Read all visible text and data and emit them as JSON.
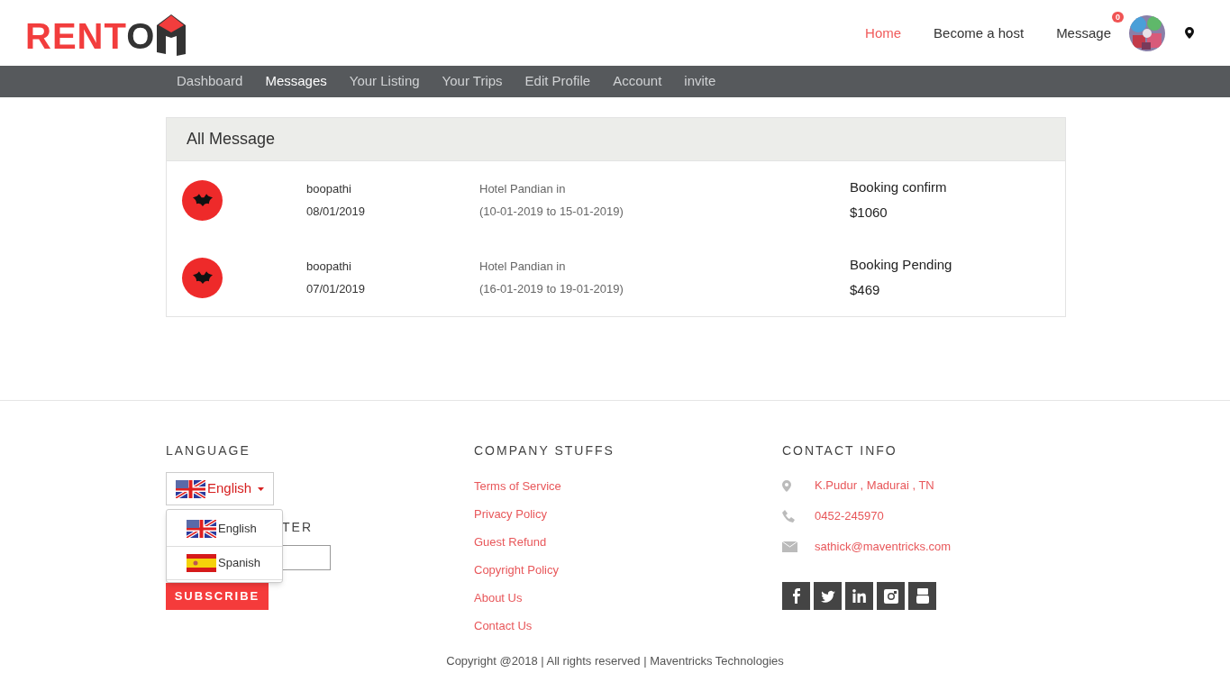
{
  "logo": {
    "text_main": "RENT",
    "text_accent": "O"
  },
  "top_nav": [
    {
      "label": "Home",
      "selected": true
    },
    {
      "label": "Become a host",
      "selected": false
    },
    {
      "label": "Message",
      "selected": false,
      "badge": "0"
    }
  ],
  "sub_nav": [
    {
      "label": "Dashboard",
      "selected": false
    },
    {
      "label": "Messages",
      "selected": true
    },
    {
      "label": "Your Listing",
      "selected": false
    },
    {
      "label": "Your Trips",
      "selected": false
    },
    {
      "label": "Edit Profile",
      "selected": false
    },
    {
      "label": "Account",
      "selected": false
    },
    {
      "label": "invite",
      "selected": false
    }
  ],
  "messages": {
    "title": "All Message",
    "rows": [
      {
        "name": "boopathi",
        "date": "08/01/2019",
        "listing": "Hotel Pandian in",
        "dates": "(10-01-2019 to 15-01-2019)",
        "status": "Booking confirm",
        "amount": "$1060"
      },
      {
        "name": "boopathi",
        "date": "07/01/2019",
        "listing": "Hotel Pandian in",
        "dates": "(16-01-2019 to 19-01-2019)",
        "status": "Booking Pending",
        "amount": "$469"
      }
    ]
  },
  "footer": {
    "language": {
      "heading": "LANGUAGE",
      "current": "English",
      "expanded": true,
      "options": [
        {
          "label": "English",
          "kind": "uk"
        },
        {
          "label": "Spanish",
          "kind": "es"
        }
      ]
    },
    "newsletter": {
      "heading": "TER",
      "button": "SUBSCRIBE"
    },
    "company": {
      "heading": "COMPANY STUFFS",
      "links": [
        "Terms of Service",
        "Privacy Policy",
        "Guest Refund",
        "Copyright Policy",
        "About Us",
        "Contact Us"
      ]
    },
    "contact": {
      "heading": "CONTACT INFO",
      "items": [
        {
          "kind": "address",
          "text": "K.Pudur , Madurai , TN"
        },
        {
          "kind": "phone",
          "text": "0452-245970"
        },
        {
          "kind": "email",
          "text": "sathick@maventricks.com"
        }
      ]
    },
    "copyright": "Copyright @2018 | All rights reserved | Maventricks Technologies"
  }
}
